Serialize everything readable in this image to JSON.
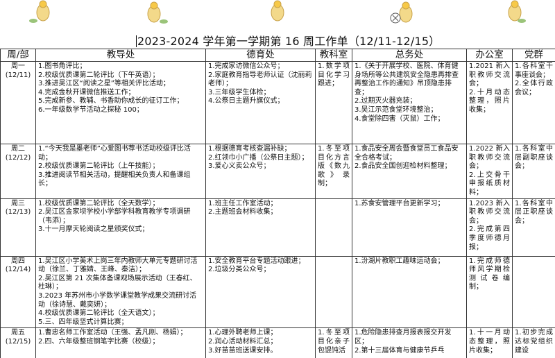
{
  "title": "2023-2024 学年第一学期第 16 周工作单（12/11-12/15）",
  "headers": [
    "周/部",
    "教导处",
    "德育处",
    "教科室",
    "总务处",
    "办公室",
    "党群"
  ],
  "weeks": [
    {
      "day": "周一",
      "date": "(12/11)",
      "jiaodao": [
        "1.图书角评比；",
        "2.校级优质课第二轮评比（下午英语）；",
        "3.推进吴江区“阅读之星”等相关评比活动；",
        "4.完成金秋开课微信推送工作；",
        "5.完成新参、教辅、书香助你成长的征订工作；",
        "6.一年级数学节活动之探秘 100；"
      ],
      "deyu": [
        "1.完成家访微信公众号；",
        "2.家庭教育指导老师认证（沈丽莉老师）；",
        "3.三年级学生体检；",
        "4.公祭日主题升旗仪式；"
      ],
      "jiaoke": [
        "1.数学项目化学习跟进；"
      ],
      "zongwu": [
        "1.《关于开展学校、医院、体育健身场所等公共建筑安全隐患再排查　再整治工作的通知》吊顶隐患排查；",
        "2.过期灭火器充装；",
        "3.吴江示范食堂环境整治；",
        "4.食堂除四害（灭鼠）工作；"
      ],
      "bangong": [
        "1.2021 新入职教师交流会；",
        "2.十月动态整理，照片收集；"
      ],
      "dangqun": [
        "1.各科室干事座谈会；",
        "2.全体行政会议；"
      ]
    },
    {
      "day": "周二",
      "date": "(12/12)",
      "jiaodao": [
        "1.“今天我是墨老师”心爱图书荐书活动校级评比活动；",
        "2.校级优质课第二轮评比（上午技能）；",
        "3.推进阅读节相关活动，提醒相关负责人和备课组长；"
      ],
      "deyu": [
        "1.根据德育考核查漏补缺；",
        "2.红领巾小广播（公祭日主题）；",
        "3.爱心义卖公众号；"
      ],
      "jiaoke": [
        "1.冬至项目化方言版《数九歌》录制；"
      ],
      "zongwu": [
        "1.食品安全周会暨食堂员工食品安全合格考试；",
        "2.食品安全国创迎检材料整理；"
      ],
      "bangong": [
        "1.2022 新入职教师交流会；",
        "2.上交骨干申报纸质材料；"
      ],
      "dangqun": [
        "1.各科室中层副职座谈会；"
      ]
    },
    {
      "day": "周三",
      "date": "(12/13)",
      "jiaodao": [
        "1.校级优质课第二轮评比（全天数学）；",
        "2.吴江区金家坝学校小学部学科教育教学专项调研（韦添）；",
        "3.十一月摩天轮阅读之星颁奖仪式；"
      ],
      "deyu": [
        "1.班主任工作室活动；",
        "2.主题班会材料收集；"
      ],
      "jiaoke": [],
      "zongwu": [
        "1.苏食安管理平台更新学习；"
      ],
      "bangong": [
        "1.2023 新入职教师交流会；",
        "2.完成第四季度师德月报；"
      ],
      "dangqun": [
        "1.各科室中层正职座谈会；"
      ]
    },
    {
      "day": "周四",
      "date": "(12/14)",
      "jiaodao": [
        "1.吴江区小学美术上岗三年内教师大单元专题研讨活动（徐兰、丁雅婧、王峰、秦洁）；",
        "2.吴江区第 21 次集体备课观场展示活动（王春红、杜琳）；",
        "3.2023 年苏州市小学数学课堂教学成果交流研讨活动（徐诗慧、戴奕妍）；",
        "4.校级优质课第二轮评比（全天语文）；",
        "5.三、四年级坚式计算比赛；"
      ],
      "deyu": [
        "1.安全教育平台专题活动跟进；",
        "2.垃圾分类公众号；"
      ],
      "jiaoke": [],
      "zongwu": [
        "1.汾湖片教职工趣味运动会；"
      ],
      "bangong": [
        "1.完成师德师风学期检测试卷编制；"
      ],
      "dangqun": []
    },
    {
      "day": "周五",
      "date": "(12/15)",
      "jiaodao": [
        "1.曹忠名师工作室活动（王强、孟凡刚、杨娟）；",
        "2.四、六年级整班钢笔字比赛（校级）；"
      ],
      "deyu": [
        "1.心理外聘老师上课；",
        "2.润心活动材料汇总；",
        "3.好苗苗班送课安排。"
      ],
      "jiaoke": [
        "1.冬至项目化亲子包馄饨活"
      ],
      "zongwu": [
        "1.危险隐患排查月报表报交开发区；",
        "2.第十三届体育与健康节乒乓"
      ],
      "bangong": [
        "1.十一月动态整理，照片收集；"
      ],
      "dangqun": [
        "1.初步完成达标党组织建设"
      ]
    }
  ]
}
